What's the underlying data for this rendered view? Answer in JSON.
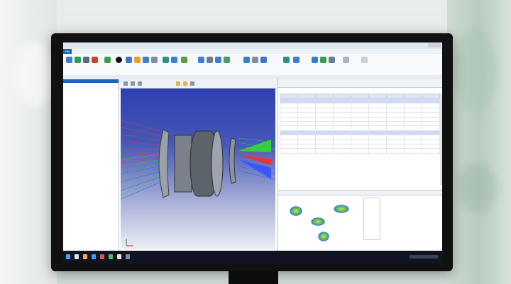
{
  "scene": {
    "colors": {
      "screen_bg": "#f4f6f9",
      "accent": "#1e64b4",
      "bezel": "#111111"
    }
  },
  "app": {
    "window_title": "",
    "menu": [
      "File",
      "",
      "",
      "",
      "",
      "",
      "",
      ""
    ],
    "left_panel_items": [
      "",
      "",
      "",
      "",
      "",
      "",
      "",
      "",
      "",
      "",
      "",
      "",
      "",
      "",
      ""
    ],
    "viewport_label": "",
    "table_title": "",
    "table_right_title": "",
    "table_headers": [
      "",
      "",
      "",
      "",
      "",
      "",
      "",
      "",
      ""
    ],
    "table_rows": [
      [
        "",
        "",
        "",
        "",
        "",
        "",
        "",
        "",
        ""
      ],
      [
        "",
        "",
        "",
        "",
        "",
        "",
        "",
        "",
        ""
      ],
      [
        "",
        "",
        "",
        "",
        "",
        "",
        "",
        "",
        ""
      ],
      [
        "",
        "",
        "",
        "",
        "",
        "",
        "",
        "",
        ""
      ],
      [
        "",
        "",
        "",
        "",
        "",
        "",
        "",
        "",
        ""
      ],
      [
        "",
        "",
        "",
        "",
        "",
        "",
        "",
        "",
        ""
      ],
      [
        "",
        "",
        "",
        "",
        "",
        "",
        "",
        "",
        ""
      ],
      [
        "",
        "",
        "",
        "",
        "",
        "",
        "",
        "",
        ""
      ],
      [
        "",
        "",
        "",
        "",
        "",
        "",
        "",
        "",
        ""
      ],
      [
        "",
        "",
        "",
        "",
        "",
        "",
        "",
        "",
        ""
      ],
      [
        "",
        "",
        "",
        "",
        "",
        "",
        "",
        "",
        ""
      ],
      [
        "",
        "",
        "",
        "",
        "",
        "",
        "",
        "",
        ""
      ]
    ],
    "spot_captions": [
      "",
      "",
      "",
      ""
    ]
  }
}
